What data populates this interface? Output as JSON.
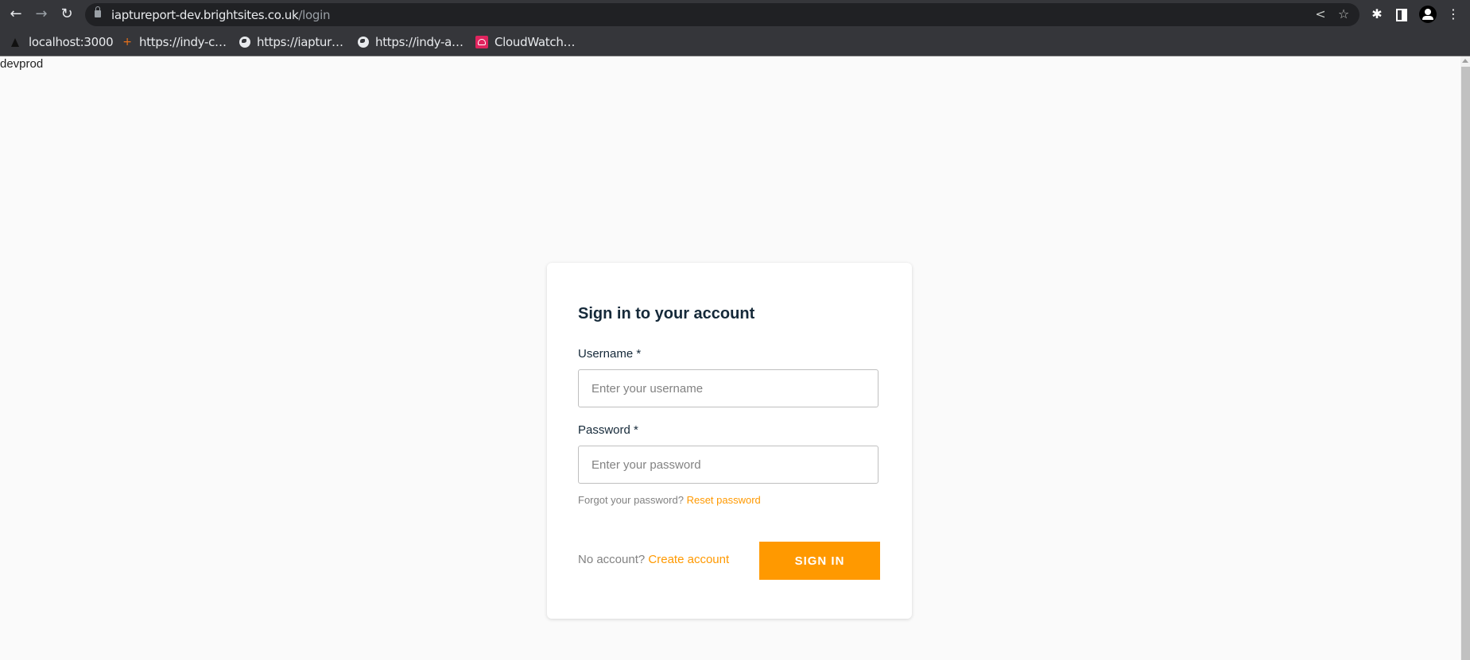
{
  "browser": {
    "url_host": "iaptureport-dev.brightsites.co.uk",
    "url_path": "/login",
    "nav": {
      "back_icon": "←",
      "forward_icon": "→",
      "reload_icon": "↻",
      "share_icon": "<",
      "star_icon": "☆",
      "extensions_icon": "✱",
      "menu_icon": "⋮"
    },
    "bookmarks": [
      {
        "label": "localhost:3000",
        "icon": "triangle-icon"
      },
      {
        "label": "https://indy-c…",
        "icon": "plus-icon"
      },
      {
        "label": "https://iaptur…",
        "icon": "globe-icon"
      },
      {
        "label": "https://indy-a…",
        "icon": "globe-icon"
      },
      {
        "label": "CloudWatch…",
        "icon": "cloudwatch-icon"
      }
    ],
    "plus_glyph": "+"
  },
  "page": {
    "env_label": "devprod"
  },
  "login": {
    "title": "Sign in to your account",
    "username_label": "Username *",
    "username_placeholder": "Enter your username",
    "username_value": "",
    "password_label": "Password *",
    "password_placeholder": "Enter your password",
    "password_value": "",
    "forgot_text": "Forgot your password?",
    "reset_link": "Reset password",
    "no_account_text": "No account?",
    "create_link": "Create account",
    "signin_button": "SIGN IN",
    "accent_color": "#ff9900"
  }
}
